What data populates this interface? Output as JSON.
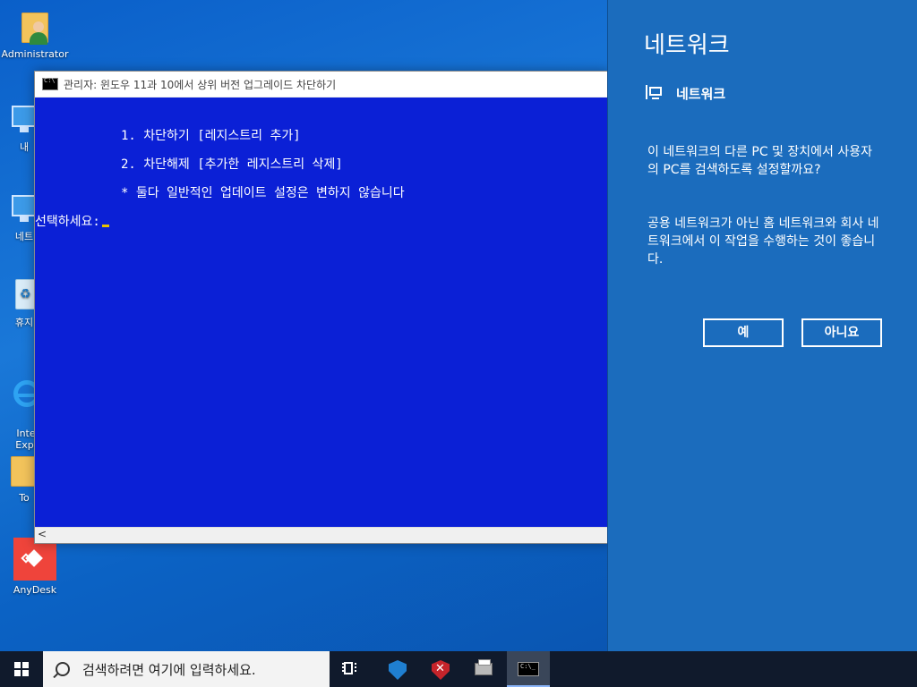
{
  "desktop": {
    "icons": [
      {
        "label": "Administrator"
      },
      {
        "label": "내"
      },
      {
        "label": "네트"
      },
      {
        "label": "휴지"
      },
      {
        "label": "Inte\nExpl"
      },
      {
        "label": "To"
      },
      {
        "label": "AnyDesk"
      }
    ]
  },
  "console": {
    "title": "관리자:  윈도우 11과 10에서 상위 버전 업그레이드 차단하기",
    "lines": [
      "1. 차단하기 [레지스트리 추가]",
      "2. 차단해제 [추가한 레지스트리 삭제]",
      "* 둘다 일반적인 업데이트 설정은 변하지 않습니다",
      "선택하세요:"
    ],
    "scroll_arrow": "<"
  },
  "network_flyout": {
    "title": "네트워크",
    "subtitle": "네트워크",
    "question": "이 네트워크의 다른 PC 및 장치에서 사용자의 PC를 검색하도록 설정할까요?",
    "description": "공용 네트워크가 아닌 홈 네트워크와 회사 네트워크에서 이 작업을 수행하는 것이 좋습니다.",
    "yes_label": "예",
    "no_label": "아니요"
  },
  "taskbar": {
    "search_placeholder": "검색하려면 여기에 입력하세요."
  }
}
